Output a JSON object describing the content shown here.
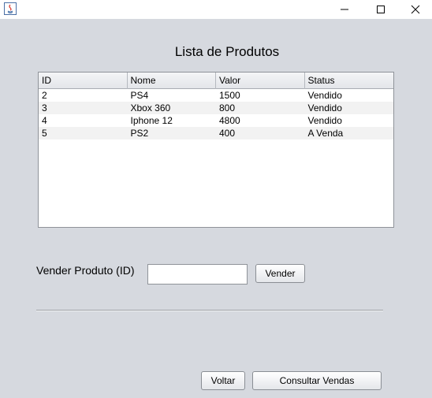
{
  "window": {
    "controls": {
      "minimize_icon": "minimize-icon",
      "maximize_icon": "maximize-icon",
      "close_icon": "close-icon"
    }
  },
  "main": {
    "title": "Lista de Produtos",
    "table": {
      "headers": [
        "ID",
        "Nome",
        "Valor",
        "Status"
      ],
      "rows": [
        [
          "2",
          "PS4",
          "1500",
          "Vendido"
        ],
        [
          "3",
          "Xbox 360",
          "800",
          "Vendido"
        ],
        [
          "4",
          "Iphone 12",
          "4800",
          "Vendido"
        ],
        [
          "5",
          "PS2",
          "400",
          "A Venda"
        ]
      ]
    },
    "sell": {
      "label": "Vender Produto (ID)",
      "input_value": "",
      "button_label": "Vender"
    }
  },
  "footer": {
    "back_label": "Voltar",
    "sales_label": "Consultar Vendas"
  }
}
